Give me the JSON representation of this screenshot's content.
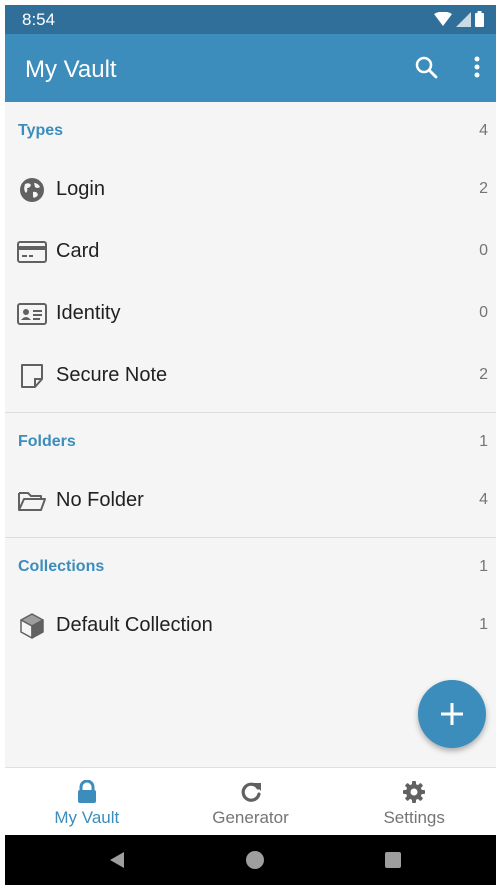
{
  "status_bar": {
    "time": "8:54"
  },
  "app_bar": {
    "title": "My Vault"
  },
  "sections": {
    "types": {
      "label": "Types",
      "count": "4",
      "items": [
        {
          "label": "Login",
          "count": "2",
          "icon": "globe-icon"
        },
        {
          "label": "Card",
          "count": "0",
          "icon": "credit-card-icon"
        },
        {
          "label": "Identity",
          "count": "0",
          "icon": "id-card-icon"
        },
        {
          "label": "Secure Note",
          "count": "2",
          "icon": "note-icon"
        }
      ]
    },
    "folders": {
      "label": "Folders",
      "count": "1",
      "items": [
        {
          "label": "No Folder",
          "count": "4",
          "icon": "folder-open-icon"
        }
      ]
    },
    "collections": {
      "label": "Collections",
      "count": "1",
      "items": [
        {
          "label": "Default Collection",
          "count": "1",
          "icon": "cube-icon"
        }
      ]
    }
  },
  "bottom_nav": {
    "items": [
      {
        "label": "My Vault",
        "icon": "lock-icon",
        "active": true
      },
      {
        "label": "Generator",
        "icon": "refresh-icon",
        "active": false
      },
      {
        "label": "Settings",
        "icon": "gear-icon",
        "active": false
      }
    ]
  },
  "colors": {
    "primary": "#3c8dbc",
    "status_bar": "#2f6f9a",
    "text": "#212121",
    "muted": "#757575"
  }
}
